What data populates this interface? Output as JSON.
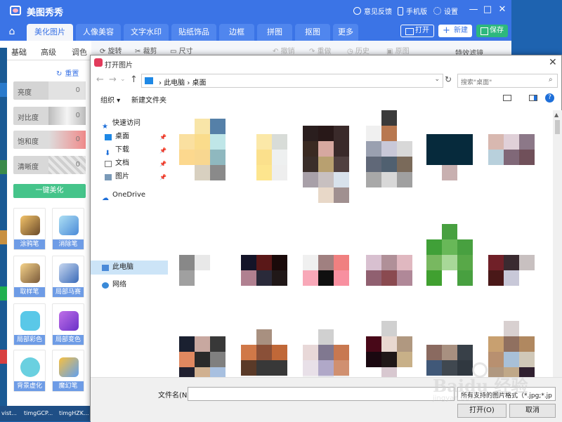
{
  "app": {
    "title": "美图秀秀",
    "title_links": [
      "意见反馈",
      "手机版",
      "设置"
    ],
    "window_controls": [
      "—",
      "□",
      "✕"
    ],
    "tabs": [
      "美化图片",
      "人像美容",
      "文字水印",
      "贴纸饰品",
      "边框",
      "拼图",
      "抠图",
      "更多"
    ],
    "active_tab": "美化图片",
    "actions": {
      "open": "打开",
      "new": "新建",
      "save": "保存"
    },
    "toolbar": {
      "rotate": "旋转",
      "crop": "裁剪",
      "size": "尺寸",
      "undo": "撤销",
      "redo": "重做",
      "history": "历史",
      "original": "原图",
      "effects": "特效滤镜"
    }
  },
  "left_panel": {
    "tabs": [
      "基础",
      "高级",
      "调色"
    ],
    "reset": "重置",
    "sliders": [
      {
        "label": "亮度",
        "value": "0"
      },
      {
        "label": "对比度",
        "value": "0"
      },
      {
        "label": "饱和度",
        "value": "0"
      },
      {
        "label": "清晰度",
        "value": "0"
      }
    ],
    "one_click": "一键美化",
    "tools": [
      "涂鸦笔",
      "消除笔",
      "取样笔",
      "局部马赛克",
      "局部彩色笔",
      "局部变色笔",
      "背景虚化",
      "魔幻笔"
    ]
  },
  "desktop_labels": [
    "vist...",
    "timgGCP...",
    "timgHZK..."
  ],
  "dialog": {
    "title": "打开图片",
    "close": "✕",
    "path": [
      "此电脑",
      "桌面"
    ],
    "search_placeholder": "搜索\"桌面\"",
    "organize": "组织 ▾",
    "new_folder": "新建文件夹",
    "help": "?",
    "nav": {
      "quick_access": "快速访问",
      "desktop": "桌面",
      "downloads": "下载",
      "documents": "文档",
      "pictures": "图片",
      "onedrive": "OneDrive",
      "this_pc": "此电脑",
      "network": "网络"
    },
    "filename_label": "文件名(N):",
    "filename_value": "",
    "filter": "所有支持的图片格式（*.jpg;*.jp",
    "open_button": "打开(O)",
    "cancel_button": "取消"
  },
  "watermark": {
    "main": "Baidu 经验",
    "sub": "jingyan.baidu.com"
  },
  "colors": {
    "brand_blue": "#3b74e6",
    "save_green": "#2db87d",
    "beautify_green": "#45c48a",
    "tool_label_blue": "#6e9ce6"
  },
  "thumbnails": [
    {
      "rows": [
        [
          "#ffffff",
          "#f8e5a8",
          "#5580a8"
        ],
        [
          "#fae0a0",
          "#fadc8c",
          "#bfe6e8"
        ],
        [
          "#fcd88e",
          "#f8d790",
          "#8fb8bf"
        ],
        [
          "#ffffff",
          "#d8d0c0",
          "#8a8a8a"
        ]
      ]
    },
    {
      "rows": [
        [
          "#ffffff",
          "#ffffff",
          "#ffffff"
        ],
        [
          "#ffffff",
          "#fbe8a8",
          "#d8dcd8"
        ],
        [
          "#ffffff",
          "#fbe08c",
          "#eef0f0"
        ],
        [
          "#ffffff",
          "#fde58e",
          "#eeeeee"
        ]
      ]
    },
    {
      "rows": [
        [
          "#ffffff",
          "#ffffff",
          "#ffffff"
        ],
        [
          "#2a1e1e",
          "#281818",
          "#3a2a2a"
        ],
        [
          "#3a2a22",
          "#d6a8a0",
          "#3a2a2a"
        ],
        [
          "#3a2e2a",
          "#b8a070",
          "#504040"
        ],
        [
          "#a8a0a8",
          "#c8c0c0",
          "#d8e2ec"
        ],
        [
          "#ffffff",
          "#e8d8c8",
          "#a09090"
        ]
      ]
    },
    {
      "rows": [
        [
          "#ffffff",
          "#3a3a3a",
          "#ffffff"
        ],
        [
          "#f0f0f0",
          "#b87850",
          "#ffffff"
        ],
        [
          "#9aa0b0",
          "#c8c8d8",
          "#d8d8d8"
        ],
        [
          "#606878",
          "#506070",
          "#7a6a5a"
        ],
        [
          "#a8a8a8",
          "#d8d8d8",
          "#a0a0a0"
        ]
      ]
    },
    {
      "rows": [
        [
          "#ffffff",
          "#ffffff",
          "#ffffff"
        ],
        [
          "#062a3c",
          "#062a3c",
          "#062a3c"
        ],
        [
          "#062a3c",
          "#062a3c",
          "#062a3c"
        ],
        [
          "#ffffff",
          "#c8b0b0",
          "#ffffff"
        ]
      ]
    },
    {
      "rows": [
        [
          "#ffffff",
          "#ffffff",
          "#ffffff"
        ],
        [
          "#d8b8b0",
          "#e0d0d8",
          "#8c7888"
        ],
        [
          "#b8d0dc",
          "#806878",
          "#70505a"
        ],
        [
          "#ffffff",
          "#ffffff",
          "#ffffff"
        ]
      ]
    },
    {
      "rows": [
        [
          "#ffffff",
          "#ffffff",
          "#ffffff"
        ],
        [
          "#888888",
          "#e8e8e8",
          "#ffffff"
        ],
        [
          "#a0a0a0",
          "#ffffff",
          "#ffffff"
        ]
      ]
    },
    {
      "rows": [
        [
          "#ffffff",
          "#ffffff",
          "#ffffff"
        ],
        [
          "#141428",
          "#5a1818",
          "#1a0a0a"
        ],
        [
          "#b08090",
          "#2a2a3a",
          "#201818"
        ]
      ]
    },
    {
      "rows": [
        [
          "#ffffff",
          "#ffffff",
          "#ffffff"
        ],
        [
          "#f0f0f0",
          "#a08080",
          "#f08080"
        ],
        [
          "#f8a8b8",
          "#101010",
          "#f890a0"
        ]
      ]
    },
    {
      "rows": [
        [
          "#ffffff",
          "#ffffff",
          "#ffffff"
        ],
        [
          "#d8c0d0",
          "#b09098",
          "#e0b8c0"
        ],
        [
          "#906070",
          "#8a4a50",
          "#b08898"
        ]
      ]
    },
    {
      "rows": [
        [
          "#ffffff",
          "#48a040",
          "#ffffff"
        ],
        [
          "#40a038",
          "#68b858",
          "#48a040"
        ],
        [
          "#78b860",
          "#a8d898",
          "#58a848"
        ],
        [
          "#40a030",
          "#ffffff",
          "#48a040"
        ]
      ]
    },
    {
      "rows": [
        [
          "#ffffff",
          "#ffffff",
          "#ffffff"
        ],
        [
          "#702028",
          "#3a2a30",
          "#c8c0c0"
        ],
        [
          "#4a1818",
          "#c8c8d8",
          "#ffffff"
        ]
      ]
    },
    {
      "rows": [
        [
          "#ffffff",
          "#ffffff",
          "#ffffff"
        ],
        [
          "#1a2030",
          "#c8a8a0",
          "#383838"
        ],
        [
          "#e08860",
          "#2a2a2a",
          "#808080"
        ],
        [
          "#202030",
          "#d0b090",
          "#a8c0e0"
        ],
        [
          "#ffffff",
          "#c8c8c8",
          "#ffffff"
        ]
      ]
    },
    {
      "rows": [
        [
          "#ffffff",
          "#a89080",
          "#ffffff"
        ],
        [
          "#d07848",
          "#8a5038",
          "#c06838"
        ],
        [
          "#5a3a28",
          "#383838",
          "#383838"
        ],
        [
          "#ffffff",
          "#ffffff",
          "#ffffff"
        ]
      ]
    },
    {
      "rows": [
        [
          "#ffffff",
          "#d0d0d0",
          "#ffffff"
        ],
        [
          "#e8d8d8",
          "#807890",
          "#c87850"
        ],
        [
          "#e8e0e8",
          "#b0a8c8",
          "#d09070"
        ],
        [
          "#f0f0f0",
          "#e0e0e8",
          "#f0f0f0"
        ]
      ]
    },
    {
      "rows": [
        [
          "#ffffff",
          "#d0d0d0",
          "#ffffff"
        ],
        [
          "#480818",
          "#e8d8d0",
          "#b09880"
        ],
        [
          "#1a0810",
          "#201818",
          "#c8b088"
        ],
        [
          "#ffffff",
          "#d8c8d0",
          "#ffffff"
        ],
        [
          "#d8c8d0",
          "#d8c8d0",
          "#ffffff"
        ]
      ]
    },
    {
      "rows": [
        [
          "#ffffff",
          "#ffffff",
          "#ffffff"
        ],
        [
          "#8a6a60",
          "#a89080",
          "#384048"
        ],
        [
          "#405878",
          "#404850",
          "#303840"
        ],
        [
          "#ffffff",
          "#ffffff",
          "#ffffff"
        ]
      ]
    },
    {
      "rows": [
        [
          "#ffffff",
          "#d8d0d0",
          "#ffffff"
        ],
        [
          "#c8a070",
          "#907060",
          "#b08860"
        ],
        [
          "#b89070",
          "#a8c0d8",
          "#d0c8b8"
        ],
        [
          "#b09880",
          "#c0a888",
          "#302030"
        ],
        [
          "#ffffff",
          "#b09898",
          "#ffffff"
        ]
      ]
    }
  ]
}
